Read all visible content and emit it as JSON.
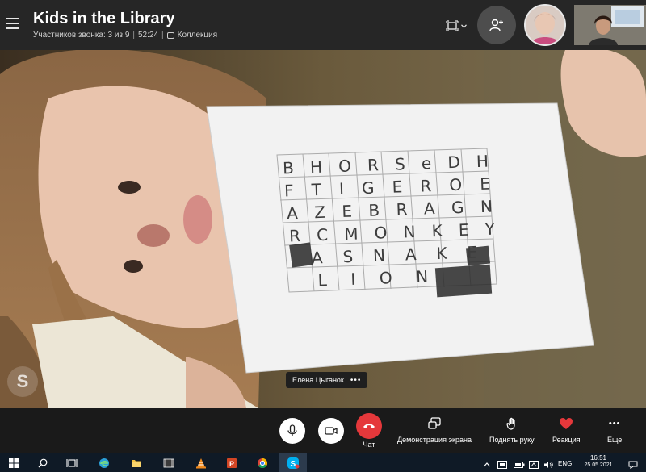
{
  "call": {
    "title": "Kids in the Library",
    "participants": "Участников звонка: 3 из 9",
    "duration": "52:24",
    "collection": "Коллекция"
  },
  "topbar": {
    "menu_icon": "hamburger-icon",
    "layout_icon": "layout-switch-icon",
    "add_icon": "add-person-icon"
  },
  "video": {
    "speaker_name": "Елена Цыганок",
    "more": "•••",
    "watermark_letter": "S",
    "paper": {
      "rows": [
        [
          "B",
          "H",
          "O",
          "R",
          "S",
          "e",
          "D",
          "H"
        ],
        [
          "F",
          "T",
          "I",
          "G",
          "E",
          "R",
          "O",
          "E"
        ],
        [
          "A",
          "Z",
          "E",
          "B",
          "R",
          "A",
          "G",
          "N"
        ],
        [
          "R",
          "C",
          "M",
          "O",
          "N",
          "K",
          "E",
          "Y"
        ],
        [
          "",
          "A",
          "S",
          "N",
          "A",
          "K",
          "E",
          ""
        ],
        [
          "",
          "L",
          "I",
          "O",
          "N",
          "",
          "",
          ""
        ]
      ]
    }
  },
  "controls": {
    "chat": "Чат",
    "share": "Демонстрация экрана",
    "raise_hand": "Поднять руку",
    "reaction": "Реакция",
    "more": "Еще",
    "more_glyph": "•••"
  },
  "taskbar": {
    "lang": "ENG",
    "time": "16:51",
    "date": "25.05.2021"
  },
  "colors": {
    "topbar_bg": "#262626",
    "end_call": "#e5383b",
    "reaction_heart": "#e5383b",
    "taskbar_bg": "#0f1a26"
  }
}
